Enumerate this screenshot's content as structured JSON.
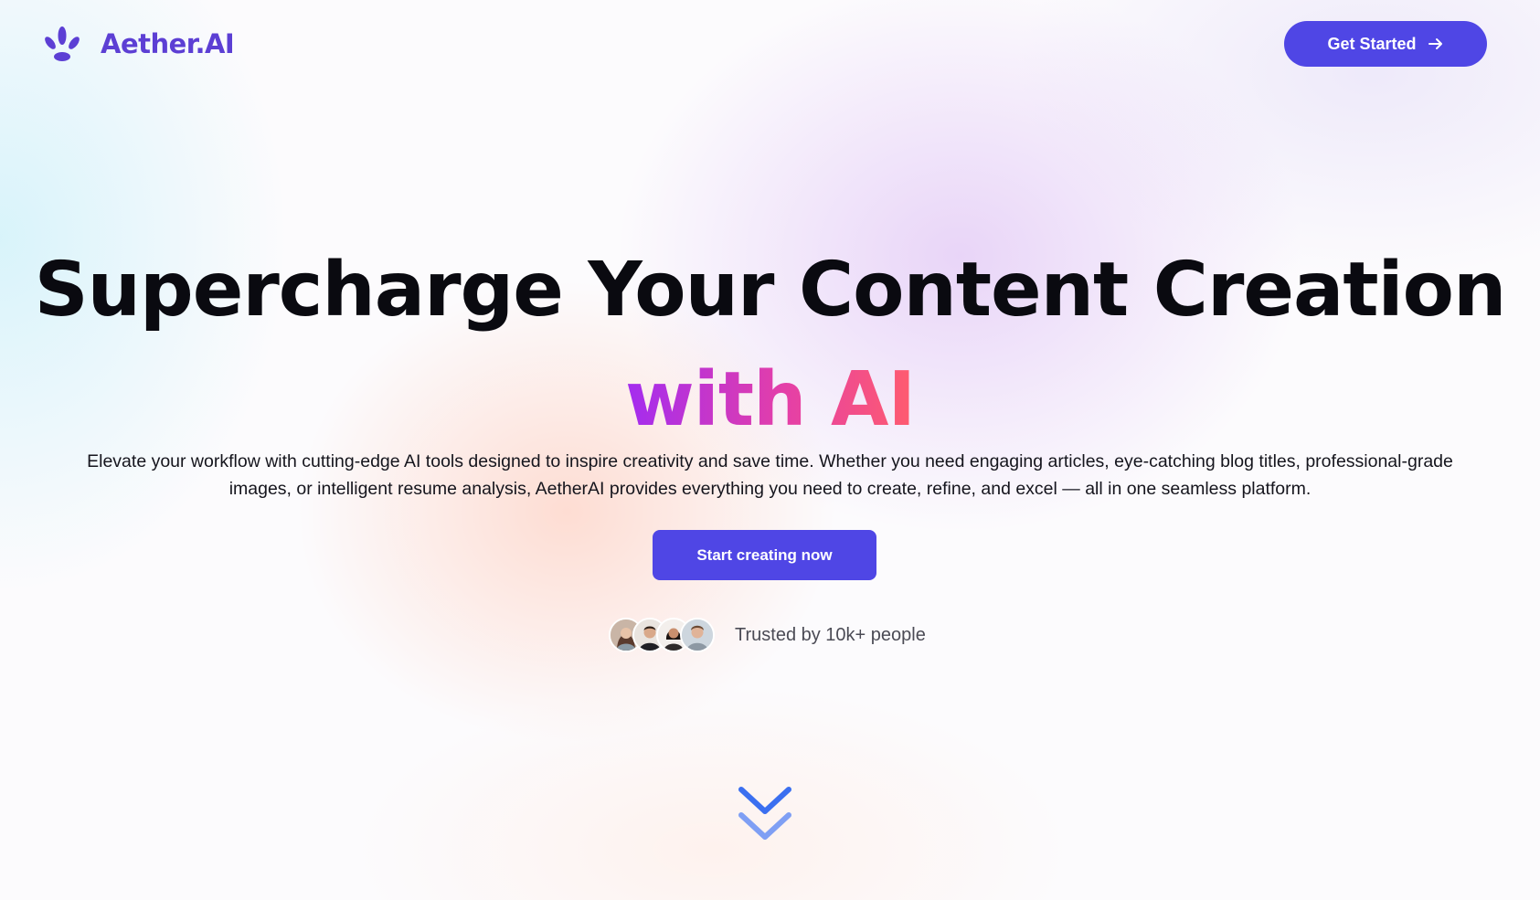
{
  "brand": {
    "name": "Aether.AI",
    "logo_icon": "lotus-icon",
    "color": "#5c3fd4"
  },
  "header": {
    "cta_label": "Get Started",
    "cta_icon": "arrow-right-icon"
  },
  "hero": {
    "title_line1": "Supercharge Your Content Creation",
    "title_line2": "with AI",
    "description": "Elevate your workflow with cutting-edge AI tools designed to inspire creativity and save time. Whether you need engaging articles, eye-catching blog titles, professional-grade images, or intelligent resume analysis, AetherAI provides everything you need to create, refine, and excel — all in one seamless platform.",
    "cta_label": "Start creating now"
  },
  "trust": {
    "text": "Trusted by 10k+ people",
    "avatars": [
      "avatar-1",
      "avatar-2",
      "avatar-3",
      "avatar-4"
    ]
  },
  "scroll_indicator": {
    "icon": "chevrons-down-icon"
  },
  "colors": {
    "primary": "#4f46e5",
    "gradient_start": "#a32cf0",
    "gradient_end": "#ff5c6e",
    "heading": "#0a0a10"
  }
}
